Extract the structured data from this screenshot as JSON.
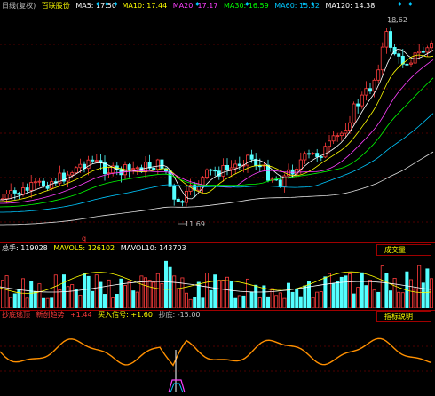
{
  "header": {
    "mode": "日线(复权)",
    "stock": "百联股份",
    "ma": [
      {
        "label": "MA5: 17.50",
        "color": "#ffffff"
      },
      {
        "label": "MA10: 17.44",
        "color": "#ffff00"
      },
      {
        "label": "MA20: 17.17",
        "color": "#ff40ff"
      },
      {
        "label": "MA30: 16.59",
        "color": "#00ff00"
      },
      {
        "label": "MA60: 15.32",
        "color": "#00c8ff"
      },
      {
        "label": "MA120: 14.38",
        "color": "#ffffff"
      }
    ]
  },
  "price": {
    "high_label": "18.62",
    "low_label": "11.69",
    "marker_q": "q"
  },
  "volume": {
    "total": "总手: 119028",
    "mavol5": "MAVOL5: 126102",
    "mavol10": "MAVOL10: 143703",
    "button": "成交量"
  },
  "indicator": {
    "title": "抄底逃顶",
    "name": "新创趋势",
    "v1": "+1.44",
    "buy": "买入信号: +1.60",
    "bottom": "抄底: -15.00",
    "button": "指标说明"
  },
  "colors": {
    "up": "#ff3c3c",
    "down": "#54ffff",
    "grid": "#a00000"
  }
}
